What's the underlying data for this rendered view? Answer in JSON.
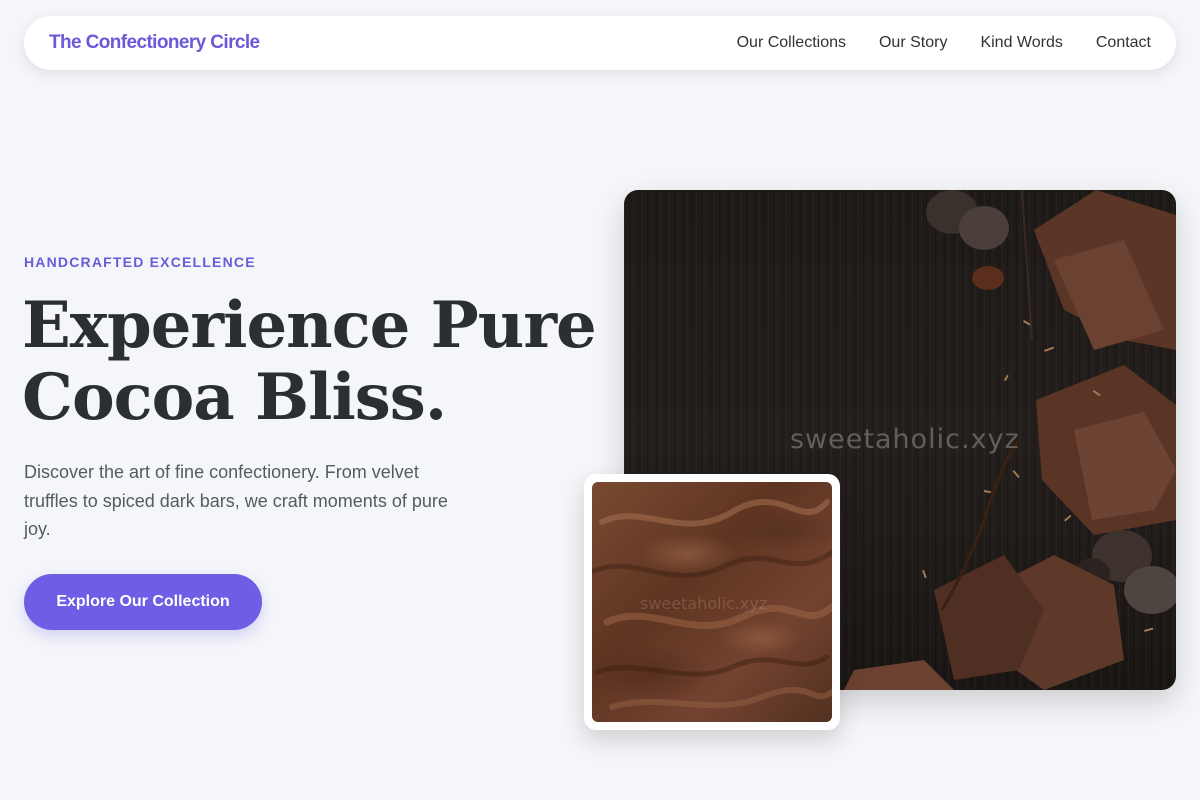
{
  "nav": {
    "brand": "The Confectionery Circle",
    "links": [
      "Our Collections",
      "Our Story",
      "Kind Words",
      "Contact"
    ]
  },
  "hero": {
    "eyebrow": "HANDCRAFTED EXCELLENCE",
    "headline_line1": "Experience Pure",
    "headline_line2": "Cocoa Bliss.",
    "lead": "Discover the art of fine confectionery. From velvet truffles to spiced dark bars, we craft moments of pure joy.",
    "cta_label": "Explore Our Collection"
  },
  "images": {
    "main_watermark": "sweetaholic.xyz",
    "inset_watermark": "sweetaholic.xyz"
  },
  "colors": {
    "accent": "#6e5ee6",
    "brand": "#6a5ad8",
    "background": "#f5f6fa",
    "text": "#2b2f33"
  }
}
